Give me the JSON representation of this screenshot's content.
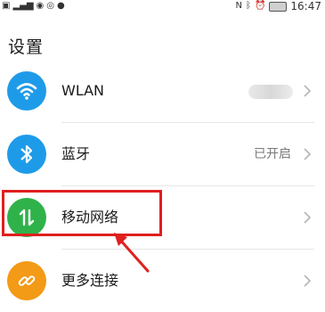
{
  "status_bar": {
    "time": "16:47",
    "left_icons": [
      "notification-icon",
      "signal-icon",
      "weibo-icon",
      "eye-icon",
      "wechat-icon"
    ],
    "right_icons": [
      "nfc-icon",
      "bluetooth-icon",
      "alarm-icon",
      "battery-icon"
    ]
  },
  "page": {
    "title": "设置"
  },
  "settings": [
    {
      "label": "WLAN",
      "value": "",
      "icon": "wifi-icon",
      "color": "#1e9be8"
    },
    {
      "label": "蓝牙",
      "value": "已开启",
      "icon": "bluetooth-icon",
      "color": "#1e9be8"
    },
    {
      "label": "移动网络",
      "value": "",
      "icon": "mobile-data-icon",
      "color": "#2fb24a"
    },
    {
      "label": "更多连接",
      "value": "",
      "icon": "link-icon",
      "color": "#f39a16"
    }
  ],
  "annotation": {
    "highlight_color": "#e01f1f"
  }
}
